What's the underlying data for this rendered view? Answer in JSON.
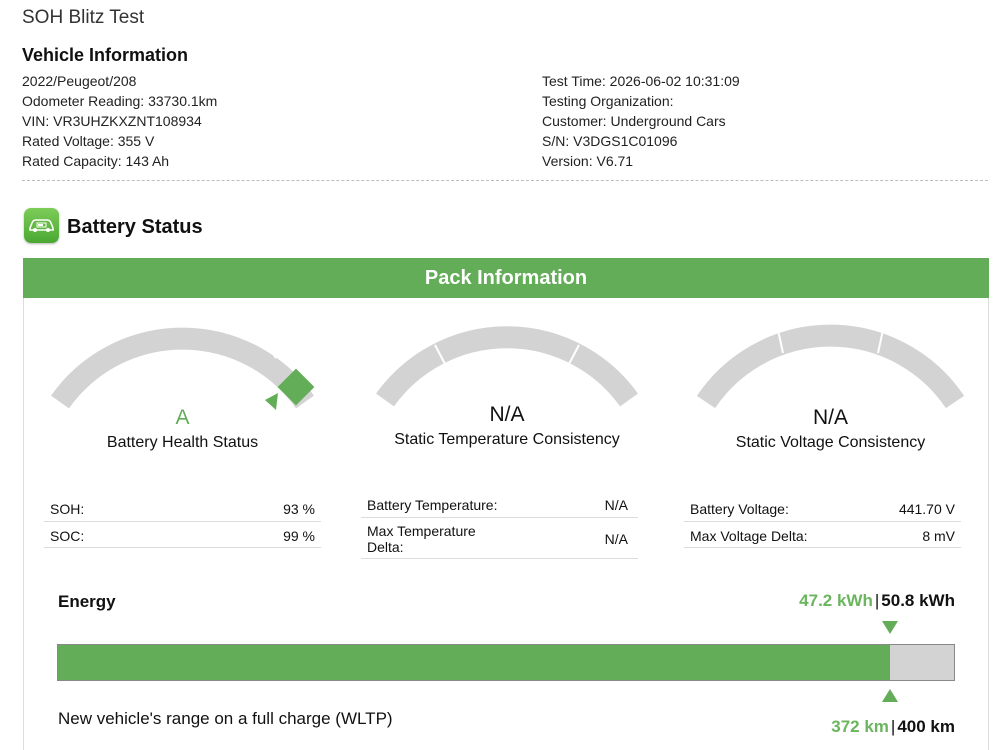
{
  "app": {
    "title": "SOH Blitz Test"
  },
  "vehicle_info": {
    "heading": "Vehicle Information",
    "left": [
      "2022/Peugeot/208",
      "Odometer Reading: 33730.1km",
      "VIN: VR3UHZKXZNT108934",
      "Rated Voltage: 355 V",
      "Rated Capacity: 143 Ah"
    ],
    "right": [
      "Test Time: 2026-06-02 10:31:09",
      "Testing Organization:",
      "Customer: Underground Cars",
      "S/N: V3DGS1C01096",
      "Version: V6.71"
    ]
  },
  "battery_status": {
    "title": "Battery Status",
    "icon": "battery-car-icon"
  },
  "pack": {
    "header": "Pack Information",
    "gauges": [
      {
        "value": "A",
        "label": "Battery Health Status",
        "value_color": "#63ad58",
        "level": 0.93
      },
      {
        "value": "N/A",
        "label": "Static Temperature Consistency",
        "value_color": "#111111"
      },
      {
        "value": "N/A",
        "label": "Static Voltage Consistency",
        "value_color": "#111111"
      }
    ],
    "tables": [
      [
        {
          "k": "SOH:",
          "v": "93 %"
        },
        {
          "k": "SOC:",
          "v": "99 %"
        }
      ],
      [
        {
          "k": "Battery Temperature:",
          "v": "N/A"
        },
        {
          "k": "Max Temperature Delta:",
          "v": "N/A"
        }
      ],
      [
        {
          "k": "Battery Voltage:",
          "v": "441.70 V"
        },
        {
          "k": "Max Voltage Delta:",
          "v": "8 mV"
        }
      ]
    ]
  },
  "energy": {
    "label": "Energy",
    "current": "47.2 kWh",
    "separator": "|",
    "total": "50.8 kWh",
    "fill_fraction": 0.929
  },
  "range": {
    "label": "New vehicle's range on a full charge (WLTP)",
    "current": "372 km",
    "separator": "|",
    "total": "400 km"
  },
  "colors": {
    "accent": "#63ad58",
    "value_green": "#6ab55d",
    "gauge_grey": "#d3d3d3"
  }
}
